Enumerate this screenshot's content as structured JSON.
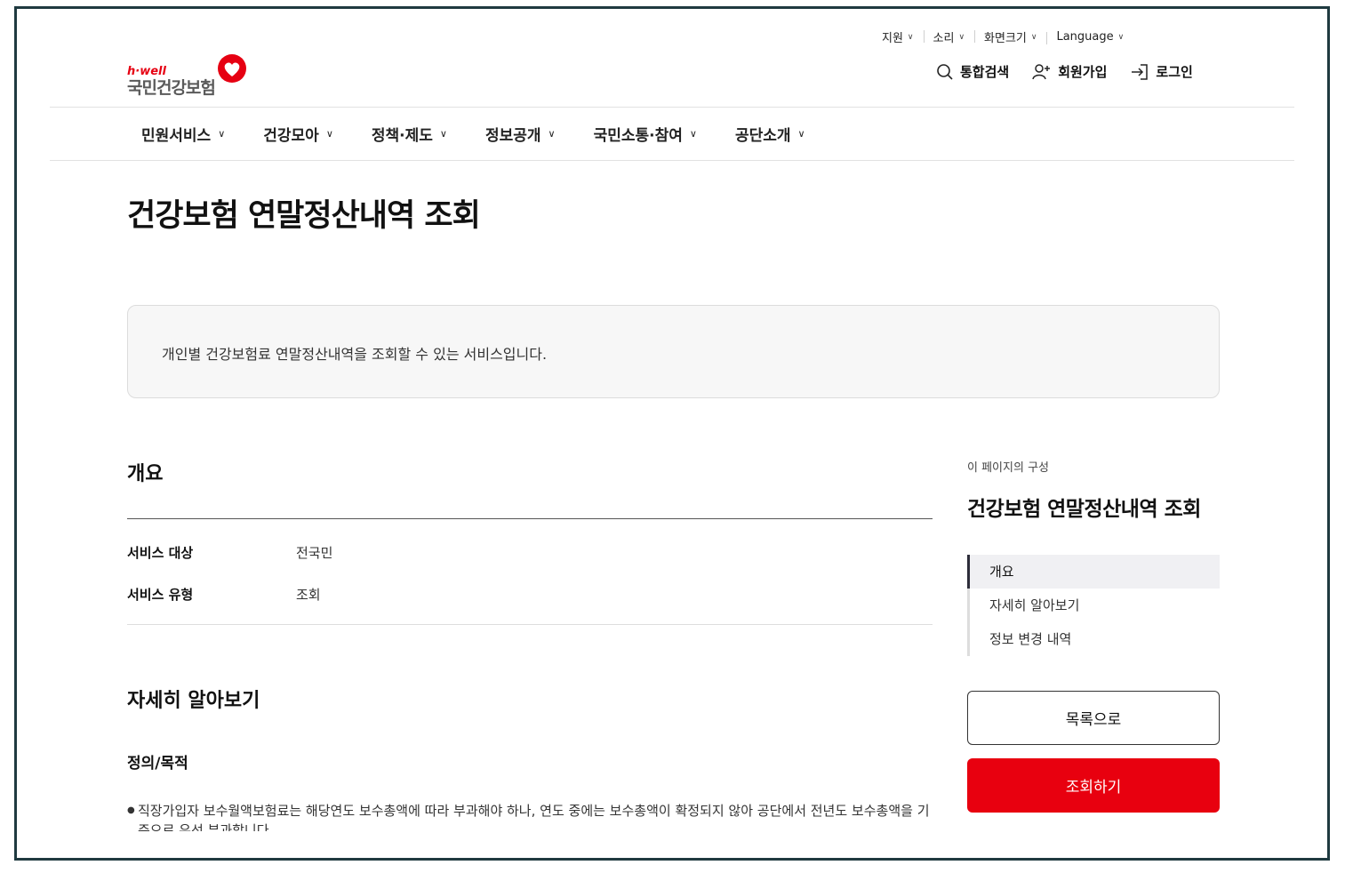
{
  "utility": [
    {
      "label": "지원"
    },
    {
      "label": "소리"
    },
    {
      "label": "화면크기"
    },
    {
      "label": "Language"
    }
  ],
  "header_actions": {
    "search": "통합검색",
    "signup": "회원가입",
    "login": "로그인"
  },
  "logo": {
    "tag": "h·well",
    "name": "국민건강보험"
  },
  "gnb": [
    {
      "label": "민원서비스"
    },
    {
      "label": "건강모아"
    },
    {
      "label": "정책·제도"
    },
    {
      "label": "정보공개"
    },
    {
      "label": "국민소통·참여"
    },
    {
      "label": "공단소개"
    }
  ],
  "page_title": "건강보험 연말정산내역 조회",
  "intro": "개인별 건강보험료 연말정산내역을 조회할 수 있는 서비스입니다.",
  "overview": {
    "title": "개요",
    "rows": [
      {
        "key": "서비스 대상",
        "value": "전국민"
      },
      {
        "key": "서비스 유형",
        "value": "조회"
      }
    ]
  },
  "details": {
    "title": "자세히 알아보기",
    "subtitle": "정의/목적",
    "bullet": "직장가입자 보수월액보험료는 해당연도 보수총액에 따라 부과해야 하나, 연도 중에는 보수총액이 확정되지 않아 공단에서 전년도 보수총액을 기준으로 우선 부과합니다"
  },
  "aside": {
    "caption": "이 페이지의 구성",
    "title": "건강보험 연말정산내역 조회",
    "toc": [
      {
        "label": "개요"
      },
      {
        "label": "자세히 알아보기"
      },
      {
        "label": "정보 변경 내역"
      }
    ],
    "list_button": "목록으로",
    "query_button": "조회하기"
  },
  "colors": {
    "brand_red": "#e8000f",
    "frame_border": "#1f3a40"
  }
}
